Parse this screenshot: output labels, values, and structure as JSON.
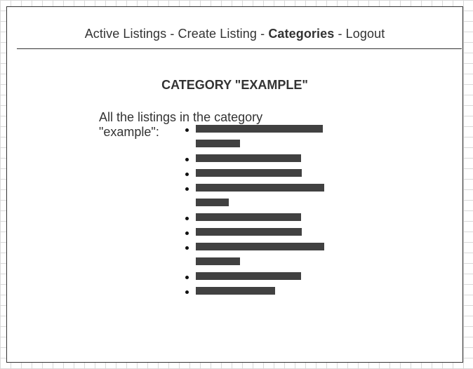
{
  "nav": {
    "items": [
      {
        "label": "Active Listings",
        "name": "nav-active-listings",
        "active": false
      },
      {
        "label": "Create Listing",
        "name": "nav-create-listing",
        "active": false
      },
      {
        "label": "Categories",
        "name": "nav-categories",
        "active": true
      },
      {
        "label": "Logout",
        "name": "nav-logout",
        "active": false
      }
    ],
    "separator": " - "
  },
  "page": {
    "title": "CATEGORY \"EXAMPLE\"",
    "intro": "All the listings in the category \"example\":"
  },
  "listings": [
    {
      "lines": [
        181,
        63
      ]
    },
    {
      "lines": [
        150
      ]
    },
    {
      "lines": [
        151
      ]
    },
    {
      "lines": [
        183,
        47
      ]
    },
    {
      "lines": [
        150
      ]
    },
    {
      "lines": [
        151
      ]
    },
    {
      "lines": [
        183,
        63
      ]
    },
    {
      "lines": [
        150
      ]
    },
    {
      "lines": [
        113
      ]
    }
  ]
}
